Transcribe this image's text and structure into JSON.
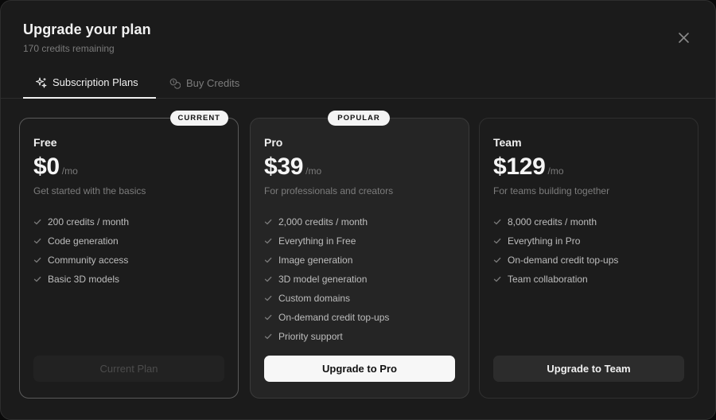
{
  "header": {
    "title": "Upgrade your plan",
    "subtitle": "170 credits remaining"
  },
  "tabs": [
    {
      "label": "Subscription Plans",
      "icon": "sparkles-icon",
      "active": true
    },
    {
      "label": "Buy Credits",
      "icon": "coins-icon",
      "active": false
    }
  ],
  "plans": [
    {
      "badge": "CURRENT",
      "name": "Free",
      "price": "$0",
      "period": "/mo",
      "description": "Get started with the basics",
      "features": [
        "200 credits / month",
        "Code generation",
        "Community access",
        "Basic 3D models"
      ],
      "cta": "Current Plan"
    },
    {
      "badge": "POPULAR",
      "name": "Pro",
      "price": "$39",
      "period": "/mo",
      "description": "For professionals and creators",
      "features": [
        "2,000 credits / month",
        "Everything in Free",
        "Image generation",
        "3D model generation",
        "Custom domains",
        "On-demand credit top-ups",
        "Priority support"
      ],
      "cta": "Upgrade to Pro"
    },
    {
      "name": "Team",
      "price": "$129",
      "period": "/mo",
      "description": "For teams building together",
      "features": [
        "8,000 credits / month",
        "Everything in Pro",
        "On-demand credit top-ups",
        "Team collaboration"
      ],
      "cta": "Upgrade to Team"
    }
  ],
  "colors": {
    "background": "#1b1b1b",
    "card_highlight": "#252525",
    "accent_button": "#f7f7f7",
    "muted_text": "#7a7a7a"
  }
}
